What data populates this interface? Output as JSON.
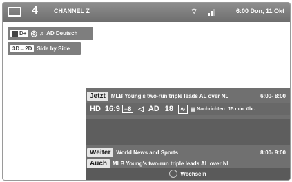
{
  "header": {
    "channel_number": "4",
    "channel_name": "CHANNEL Z",
    "datetime": "6:00 Don, 11 Okt"
  },
  "audio": {
    "dolby_label": "D+",
    "surround_label": "AD Deutsch"
  },
  "mode": {
    "label": "3D→2D",
    "value": "Side by Side"
  },
  "now": {
    "label": "Jetzt",
    "title": "MLB Young's two-run triple leads AL over NL",
    "time": "6:00- 8:00"
  },
  "badges": {
    "hd": "HD",
    "aspect": "16:9",
    "subtitle": "8",
    "audio_desc": "AD",
    "age": "18",
    "genre": "Nachrichten",
    "remaining": "15 min. übr."
  },
  "next": {
    "label": "Weiter",
    "title": "World News and Sports",
    "time": "8:00- 9:00"
  },
  "also": {
    "label": "Auch",
    "title": "MLB Young's two-run triple leads AL over NL"
  },
  "footer": {
    "action": "Wechseln"
  }
}
